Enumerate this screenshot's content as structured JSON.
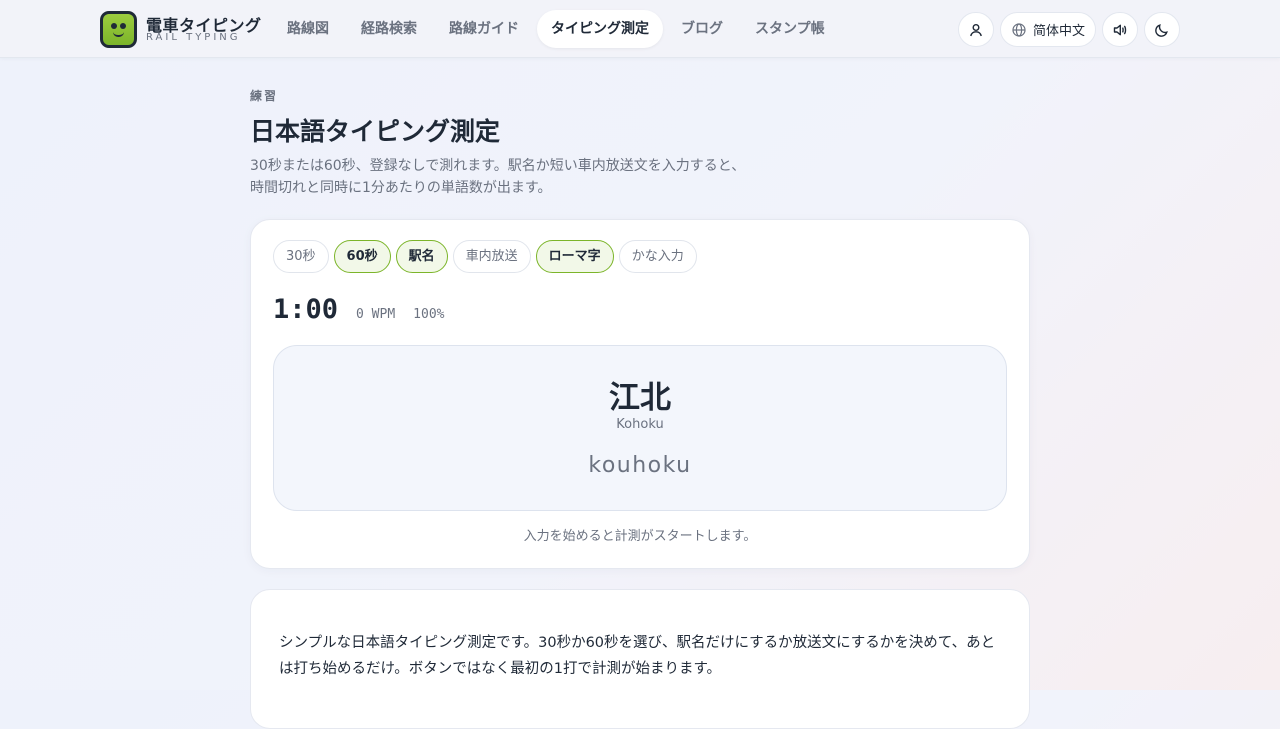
{
  "brand": {
    "title": "電車タイピング",
    "subtitle": "RAIL TYPING"
  },
  "nav": {
    "items": [
      {
        "label": "路線図"
      },
      {
        "label": "経路検索"
      },
      {
        "label": "路線ガイド"
      },
      {
        "label": "タイピング測定",
        "active": true
      },
      {
        "label": "ブログ"
      },
      {
        "label": "スタンプ帳"
      }
    ]
  },
  "header_actions": {
    "profile_icon": "user-icon",
    "language_label": "简体中文",
    "language_icon": "globe-icon",
    "sound_icon": "speaker-icon",
    "theme_icon": "moon-icon"
  },
  "intro": {
    "eyebrow": "練習",
    "title": "日本語タイピング測定",
    "description": "30秒または60秒、登録なしで測れます。駅名か短い車内放送文を入力すると、時間切れと同時に1分あたりの単語数が出ます。"
  },
  "test": {
    "options": [
      {
        "label": "30秒",
        "selected": false
      },
      {
        "label": "60秒",
        "selected": true
      },
      {
        "label": "駅名",
        "selected": true
      },
      {
        "label": "車内放送",
        "selected": false
      },
      {
        "label": "ローマ字",
        "selected": true
      },
      {
        "label": "かな入力",
        "selected": false
      }
    ],
    "timer": "1:00",
    "wpm": "0 WPM",
    "accuracy": "100%",
    "prompt": {
      "kanji": "江北",
      "english": "Kohoku",
      "romaji": "kouhoku"
    },
    "hint": "入力を始めると計測がスタートします。"
  },
  "info": {
    "text": "シンプルな日本語タイピング測定です。30秒か60秒を選び、駅名だけにするか放送文にするかを決めて、あとは打ち始めるだけ。ボタンではなく最初の1打で計測が始まります。"
  },
  "colors": {
    "accent": "#7cb52a",
    "text": "#1f2937",
    "muted": "#6b7280"
  }
}
